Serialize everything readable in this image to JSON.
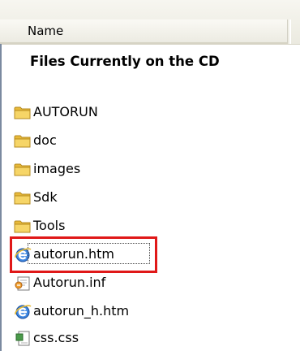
{
  "header": {
    "column_name": "Name"
  },
  "group_title": "Files Currently on the CD",
  "files": [
    {
      "name": "AUTORUN",
      "icon": "folder-icon"
    },
    {
      "name": "doc",
      "icon": "folder-icon"
    },
    {
      "name": "images",
      "icon": "folder-icon"
    },
    {
      "name": "Sdk",
      "icon": "folder-icon"
    },
    {
      "name": "Tools",
      "icon": "folder-icon"
    },
    {
      "name": "autorun.htm",
      "icon": "ie-document-icon",
      "selected": true
    },
    {
      "name": "Autorun.inf",
      "icon": "setup-info-icon"
    },
    {
      "name": "autorun_h.htm",
      "icon": "ie-document-icon"
    },
    {
      "name": "css.css",
      "icon": "css-file-icon"
    }
  ],
  "colors": {
    "highlight_border": "#e01818",
    "folder_yellow": "#f3cd57",
    "ie_blue": "#2b6fd6"
  }
}
